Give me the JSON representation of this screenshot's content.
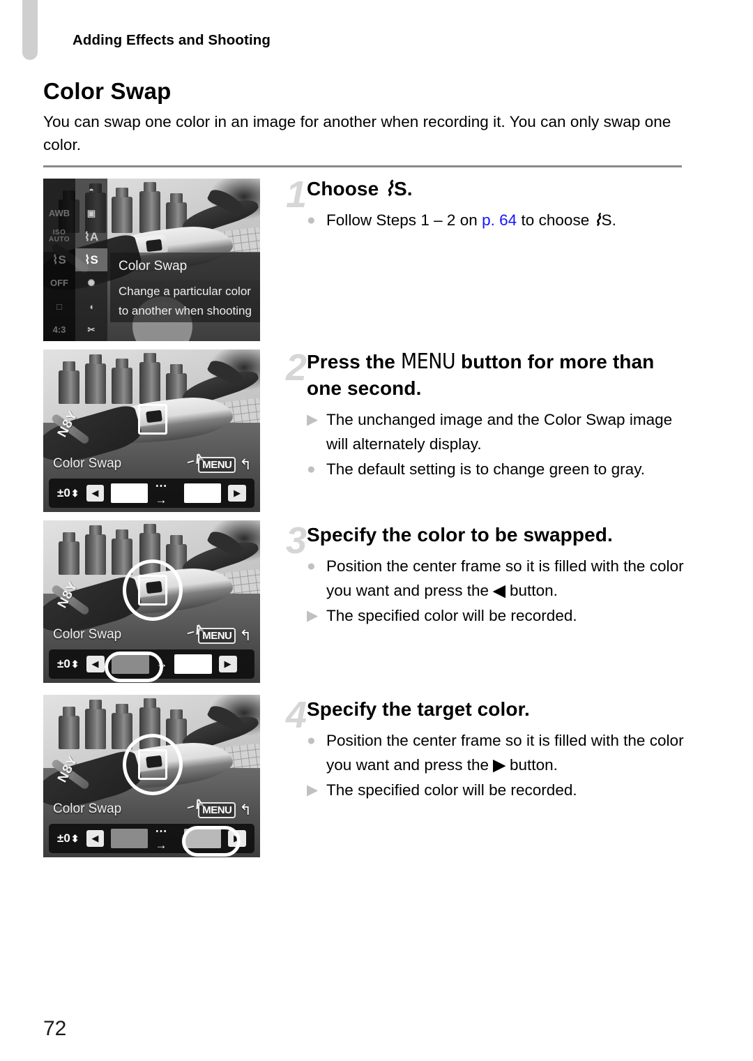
{
  "page": {
    "running_header": "Adding Effects and Shooting",
    "page_number": "72"
  },
  "section": {
    "title": "Color Swap",
    "intro": "You can swap one color in an image for another when recording it. You can only swap one color."
  },
  "steps": [
    {
      "number": "1",
      "heading_before": "Choose ",
      "heading_icon": "color-swap-dropper-icon",
      "heading_icon_glyph": "⌇",
      "heading_icon_label": "S",
      "heading_after": ".",
      "bullets": [
        {
          "marker": "●",
          "marker_type": "action-bullet",
          "text_before": "Follow Steps 1 – 2 on ",
          "link": "p. 64",
          "text_middle": " to choose ",
          "icon_label": "S",
          "text_after": "."
        }
      ]
    },
    {
      "number": "2",
      "heading_before": "Press the ",
      "heading_menu_word": "MENU",
      "heading_after": " button for more than one second.",
      "bullets": [
        {
          "marker": "▶",
          "marker_type": "result-bullet",
          "text": "The unchanged image and the Color Swap image will alternately display."
        },
        {
          "marker": "●",
          "marker_type": "action-bullet",
          "text": "The default setting is to change green to gray."
        }
      ]
    },
    {
      "number": "3",
      "heading": "Specify the color to be swapped.",
      "bullets": [
        {
          "marker": "●",
          "marker_type": "action-bullet",
          "text_before": "Position the center frame so it is filled with the color you want and press the ",
          "icon": "◀",
          "icon_name": "left-arrow-button-icon",
          "text_after": " button."
        },
        {
          "marker": "▶",
          "marker_type": "result-bullet",
          "text": "The specified color will be recorded."
        }
      ]
    },
    {
      "number": "4",
      "heading": "Specify the target color.",
      "bullets": [
        {
          "marker": "●",
          "marker_type": "action-bullet",
          "text_before": "Position the center frame so it is filled with the color you want and press the ",
          "icon": "▶",
          "icon_name": "right-arrow-button-icon",
          "text_after": " button."
        },
        {
          "marker": "▶",
          "marker_type": "result-bullet",
          "text": "The specified color will be recorded."
        }
      ]
    }
  ],
  "screenshots": {
    "shot1": {
      "menu_column_a": [
        "",
        "AWB",
        "ISO AUTO",
        "S",
        "OFF",
        "□",
        "4:3"
      ],
      "menu_column_b": [
        "◓",
        "▣",
        "A",
        "S",
        "✺",
        "◖",
        "✂"
      ],
      "selected_index": 3,
      "overlay_title": "Color Swap",
      "overlay_desc_line1": "Change a particular color",
      "overlay_desc_line2": "to another when shooting"
    },
    "shot2": {
      "hud_label": "Color Swap",
      "menu_chip": "MENU",
      "return_glyph": "↰",
      "ev_value": "±0",
      "updown_glyph": "⬍",
      "left_button": "◀",
      "right_button": "▶",
      "transition_glyph": "⋯→",
      "source_swatch_color": "#ffffff",
      "target_swatch_color": "#ffffff",
      "highlight": "none"
    },
    "shot3": {
      "hud_label": "Color Swap",
      "menu_chip": "MENU",
      "return_glyph": "↰",
      "ev_value": "±0",
      "updown_glyph": "⬍",
      "left_button": "◀",
      "right_button": "▶",
      "transition_glyph": "→",
      "source_swatch_color": "#8b8b8b",
      "target_swatch_color": "#ffffff",
      "highlight": "source"
    },
    "shot4": {
      "hud_label": "Color Swap",
      "menu_chip": "MENU",
      "return_glyph": "↰",
      "ev_value": "±0",
      "updown_glyph": "⬍",
      "left_button": "◀",
      "right_button": "▶",
      "transition_glyph": "⋯→",
      "source_swatch_color": "#8b8b8b",
      "target_swatch_color": "#b9b9b9",
      "highlight": "target"
    },
    "plane_reg_left": "N8Y",
    "plane_reg_right": "–A"
  },
  "colors": {
    "link": "#1414ff",
    "step_number": "#d6d6d6",
    "bullet_marker": "#c0c0c0",
    "rule": "#8a8a8a",
    "chapter_tab": "#cfcfcf"
  }
}
